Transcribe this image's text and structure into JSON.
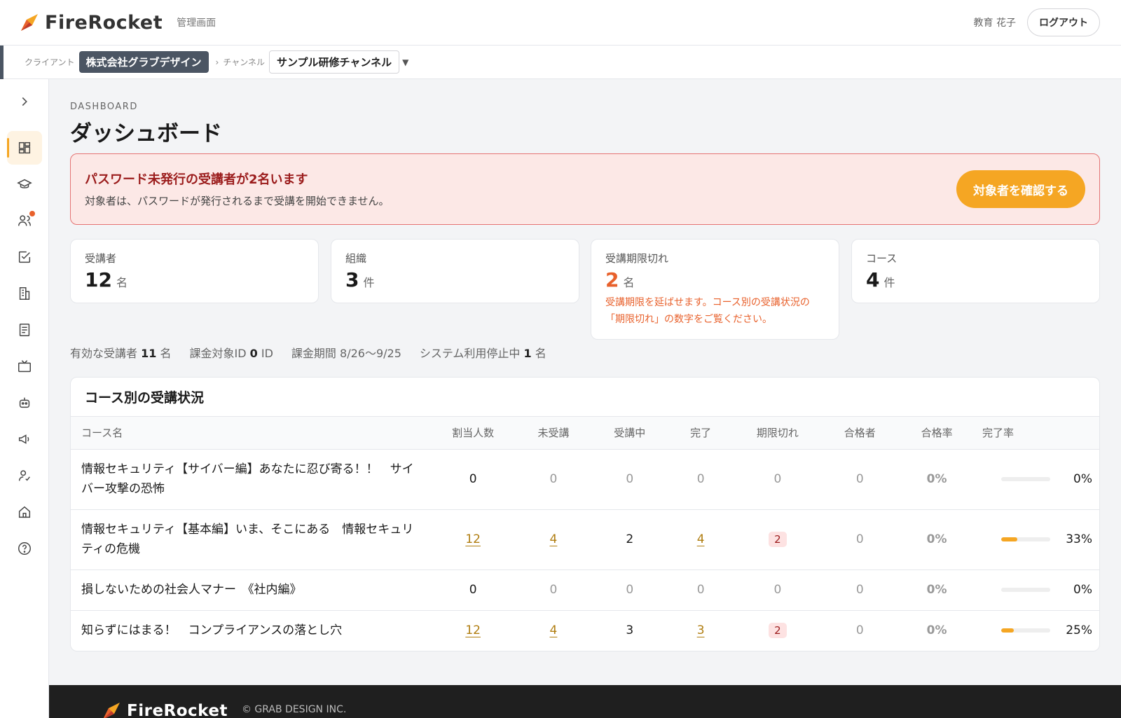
{
  "header": {
    "logo_text": "FireRocket",
    "subtitle": "管理画面",
    "user_name": "教育 花子",
    "logout_label": "ログアウト"
  },
  "context": {
    "client_label": "クライアント",
    "client_value": "株式会社グラブデザイン",
    "channel_label": "チャンネル",
    "channel_value": "サンプル研修チャンネル"
  },
  "sidebar": {
    "items": [
      {
        "name": "dashboard",
        "icon": "grid-icon",
        "active": true
      },
      {
        "name": "courses",
        "icon": "graduation-cap-icon"
      },
      {
        "name": "users",
        "icon": "users-icon",
        "badge": true
      },
      {
        "name": "tasks",
        "icon": "check-square-icon"
      },
      {
        "name": "organizations",
        "icon": "building-icon"
      },
      {
        "name": "books",
        "icon": "book-icon"
      },
      {
        "name": "videos",
        "icon": "tv-icon"
      },
      {
        "name": "bot",
        "icon": "robot-icon"
      },
      {
        "name": "announcements",
        "icon": "megaphone-icon"
      },
      {
        "name": "user-check",
        "icon": "user-check-icon"
      },
      {
        "name": "home",
        "icon": "home-icon"
      },
      {
        "name": "help",
        "icon": "help-circle-icon"
      }
    ]
  },
  "page": {
    "eyebrow": "DASHBOARD",
    "title": "ダッシュボード"
  },
  "alert": {
    "title": "パスワード未発行の受講者が2名います",
    "desc": "対象者は、パスワードが発行されるまで受講を開始できません。",
    "button": "対象者を確認する"
  },
  "stats": [
    {
      "label": "受講者",
      "value": "12",
      "unit": "名"
    },
    {
      "label": "組織",
      "value": "3",
      "unit": "件"
    },
    {
      "label": "受講期限切れ",
      "value": "2",
      "unit": "名",
      "note": "受講期限を延ばせます。コース別の受講状況の「期限切れ」の数字をご覧ください。"
    },
    {
      "label": "コース",
      "value": "4",
      "unit": "件"
    }
  ],
  "summary": {
    "active_label": "有効な受講者",
    "active_value": "11",
    "active_unit": "名",
    "billing_label": "課金対象ID",
    "billing_value": "0",
    "billing_unit": "ID",
    "period_label": "課金期間",
    "period_value": "8/26〜9/25",
    "suspended_label": "システム利用停止中",
    "suspended_value": "1",
    "suspended_unit": "名"
  },
  "table": {
    "title": "コース別の受講状況",
    "headers": [
      "コース名",
      "割当人数",
      "未受講",
      "受講中",
      "完了",
      "期限切れ",
      "合格者",
      "合格率",
      "完了率"
    ],
    "rows": [
      {
        "course": "情報セキュリティ【サイバー編】あなたに忍び寄る！！　サイバー攻撃の恐怖",
        "assigned": "0",
        "not_started": "0",
        "in_progress": "0",
        "completed": "0",
        "expired": "0",
        "passed": "0",
        "pass_rate": "0%",
        "completion_rate": "0%",
        "completion_fraction": 0
      },
      {
        "course": "情報セキュリティ【基本編】いま、そこにある　情報セキュリティの危機",
        "assigned": "12",
        "not_started": "4",
        "in_progress": "2",
        "completed": "4",
        "expired": "2",
        "passed": "0",
        "pass_rate": "0%",
        "completion_rate": "33%",
        "completion_fraction": 0.33
      },
      {
        "course": "損しないための社会人マナー　《社内編》",
        "assigned": "0",
        "not_started": "0",
        "in_progress": "0",
        "completed": "0",
        "expired": "0",
        "passed": "0",
        "pass_rate": "0%",
        "completion_rate": "0%",
        "completion_fraction": 0
      },
      {
        "course": "知らずにはまる！　コンプライアンスの落とし穴",
        "assigned": "12",
        "not_started": "4",
        "in_progress": "3",
        "completed": "3",
        "expired": "2",
        "passed": "0",
        "pass_rate": "0%",
        "completion_rate": "25%",
        "completion_fraction": 0.25
      }
    ]
  },
  "footer": {
    "logo_text": "FireRocket",
    "copyright": "© GRAB DESIGN INC."
  },
  "colors": {
    "accent": "#f5a623",
    "warn": "#e8612c",
    "alert_bg": "#fce8e6",
    "alert_text": "#9b1c1c"
  }
}
